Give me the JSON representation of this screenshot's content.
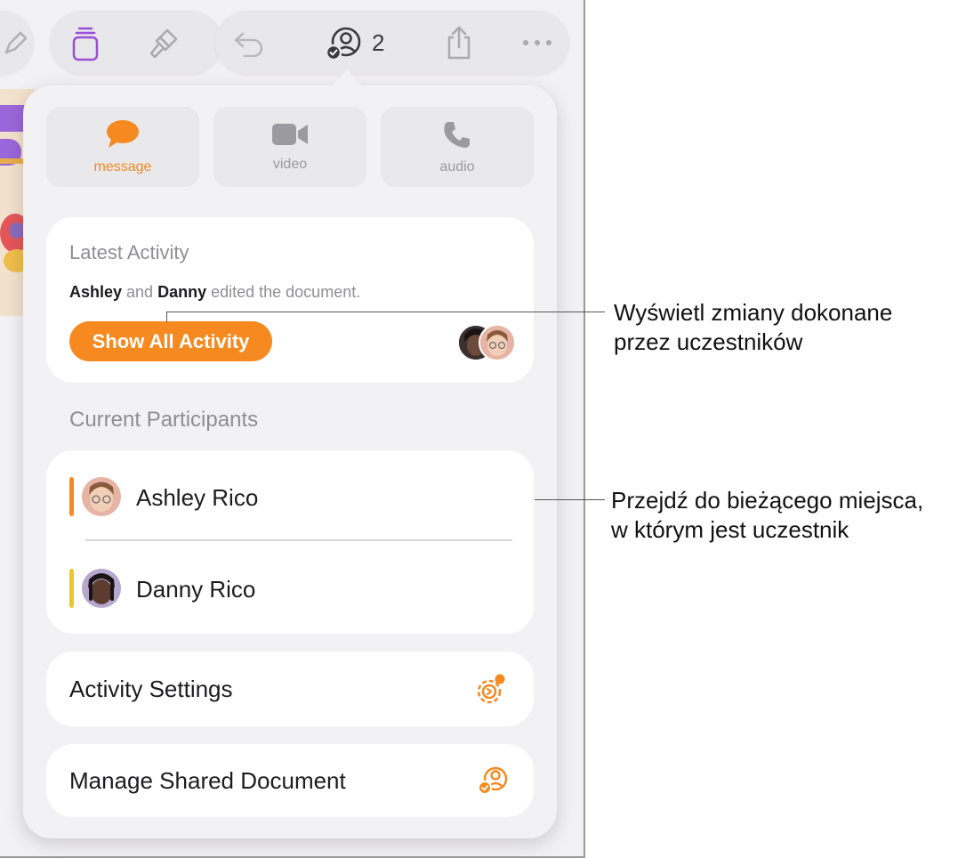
{
  "toolbar": {
    "collaborator_count": "2"
  },
  "comm_options": [
    {
      "label": "message",
      "icon": "message-bubble-icon",
      "active": true
    },
    {
      "label": "video",
      "icon": "video-camera-icon",
      "active": false
    },
    {
      "label": "audio",
      "icon": "phone-icon",
      "active": false
    }
  ],
  "latest_activity": {
    "title": "Latest Activity",
    "name1": "Ashley",
    "connector": " and ",
    "name2": "Danny",
    "suffix": " edited the document.",
    "button_label": "Show All Activity"
  },
  "participants": {
    "title": "Current Participants",
    "items": [
      {
        "name": "Ashley Rico",
        "color": "#f6891f"
      },
      {
        "name": "Danny Rico",
        "color": "#e8c82a"
      }
    ]
  },
  "settings_rows": {
    "activity_settings": "Activity Settings",
    "manage_shared": "Manage Shared Document"
  },
  "callouts": {
    "show_activity": {
      "line1": "Wyświetl zmiany dokonane",
      "line2": "przez uczestników"
    },
    "go_to_participant": {
      "line1": "Przejdź do bieżącego miejsca,",
      "line2": "w którym jest uczestnik"
    }
  },
  "colors": {
    "accent": "#f6891f",
    "secondary_text": "#8e8e93"
  }
}
